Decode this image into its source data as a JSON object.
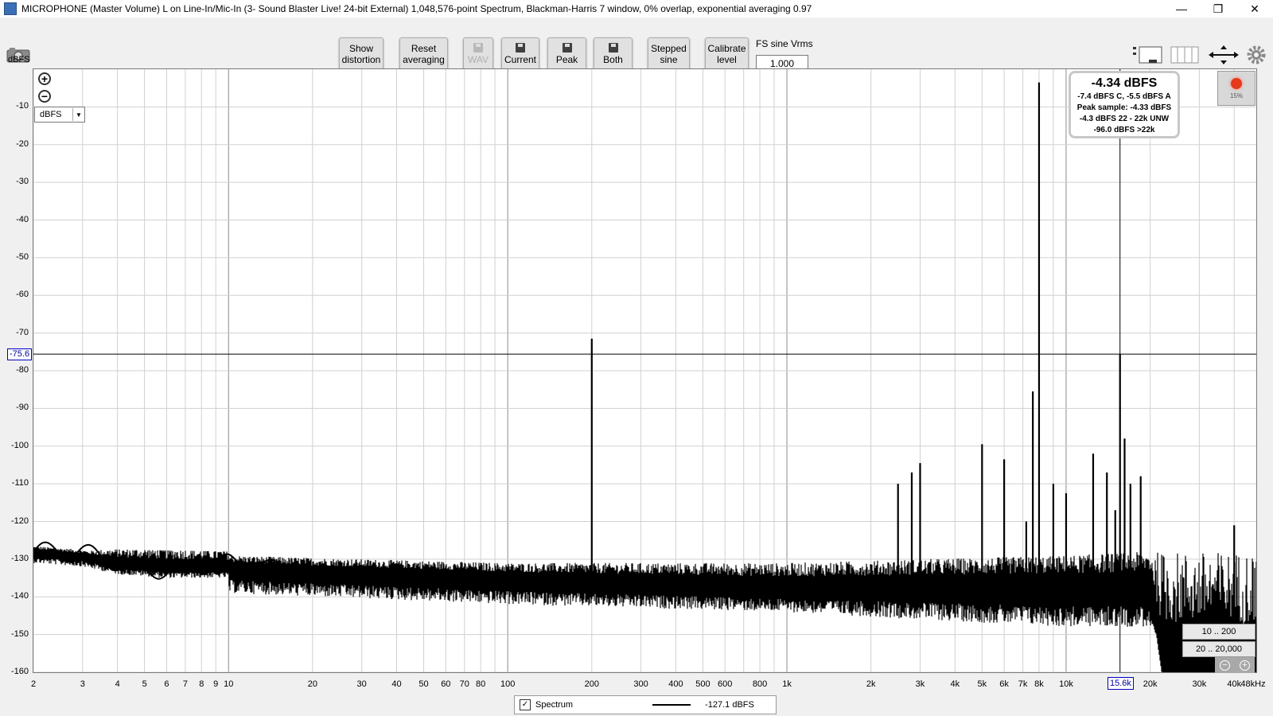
{
  "window": {
    "title": "MICROPHONE (Master Volume) L on Line-In/Mic-In (3- Sound Blaster Live! 24-bit External) 1,048,576-point Spectrum, Blackman-Harris 7 window, 0% overlap, exponential averaging 0.97",
    "minimize": "—",
    "restore": "❐",
    "close": "✕"
  },
  "toolbar": {
    "show_distortion": [
      "Show",
      "distortion"
    ],
    "reset_averaging": [
      "Reset",
      "averaging"
    ],
    "wav": "WAV",
    "current": "Current",
    "peak": "Peak",
    "both": "Both",
    "stepped_sine": [
      "Stepped",
      "sine"
    ],
    "calibrate_level": [
      "Calibrate",
      "level"
    ],
    "fs_label": "FS sine Vrms",
    "fs_value": "1.000"
  },
  "unit_select": "dBFS",
  "cursor": {
    "y_value": "-75.6",
    "x_value": "15.6k"
  },
  "readout": {
    "main": "-4.34 dBFS",
    "lines": [
      "-7.4 dBFS C, -5.5 dBFS A",
      "Peak sample: -4.33 dBFS",
      "-4.3 dBFS 22 - 22k UNW",
      "-96.0 dBFS >22k"
    ]
  },
  "record": {
    "pct": "15%"
  },
  "ranges": [
    "10 .. 200",
    "20 .. 20,000"
  ],
  "legend": {
    "name": "Spectrum",
    "value": "-127.1 dBFS"
  },
  "colors": {
    "trace": "#000000",
    "grid": "#d0d0d0",
    "grid_major": "#8a8a8a",
    "cursor": "#000000",
    "badge": "#0000c0"
  },
  "chart_data": {
    "type": "line",
    "title": "",
    "ylabel": "dBFS",
    "xlabel": "",
    "x_scale": "log",
    "xlim": [
      2,
      48000
    ],
    "ylim": [
      -160,
      0
    ],
    "grid": true,
    "yticks": [
      -10,
      -20,
      -30,
      -40,
      -50,
      -60,
      -70,
      -80,
      -90,
      -100,
      -110,
      -120,
      -130,
      -140,
      -150,
      -160
    ],
    "xticks": [
      {
        "v": 2,
        "t": "2"
      },
      {
        "v": 3,
        "t": "3"
      },
      {
        "v": 4,
        "t": "4"
      },
      {
        "v": 5,
        "t": "5"
      },
      {
        "v": 6,
        "t": "6"
      },
      {
        "v": 7,
        "t": "7"
      },
      {
        "v": 8,
        "t": "8"
      },
      {
        "v": 9,
        "t": "9"
      },
      {
        "v": 10,
        "t": "10"
      },
      {
        "v": 20,
        "t": "20"
      },
      {
        "v": 30,
        "t": "30"
      },
      {
        "v": 40,
        "t": "40"
      },
      {
        "v": 50,
        "t": "50"
      },
      {
        "v": 60,
        "t": "60"
      },
      {
        "v": 70,
        "t": "70"
      },
      {
        "v": 80,
        "t": "80"
      },
      {
        "v": 100,
        "t": "100"
      },
      {
        "v": 200,
        "t": "200"
      },
      {
        "v": 300,
        "t": "300"
      },
      {
        "v": 400,
        "t": "400"
      },
      {
        "v": 500,
        "t": "500"
      },
      {
        "v": 600,
        "t": "600"
      },
      {
        "v": 800,
        "t": "800"
      },
      {
        "v": 1000,
        "t": "1k"
      },
      {
        "v": 2000,
        "t": "2k"
      },
      {
        "v": 3000,
        "t": "3k"
      },
      {
        "v": 4000,
        "t": "4k"
      },
      {
        "v": 5000,
        "t": "5k"
      },
      {
        "v": 6000,
        "t": "6k"
      },
      {
        "v": 7000,
        "t": "7k"
      },
      {
        "v": 8000,
        "t": "8k"
      },
      {
        "v": 10000,
        "t": "10k"
      },
      {
        "v": 20000,
        "t": "20k"
      },
      {
        "v": 30000,
        "t": "30k"
      },
      {
        "v": 40000,
        "t": "40k"
      },
      {
        "v": 48000,
        "t": "48kHz"
      }
    ],
    "series": [
      {
        "name": "Spectrum",
        "noise_floor": [
          [
            2,
            -128
          ],
          [
            3,
            -129
          ],
          [
            4,
            -131
          ],
          [
            6,
            -132
          ],
          [
            10,
            -132
          ],
          [
            20,
            -133
          ],
          [
            50,
            -134
          ],
          [
            100,
            -135
          ],
          [
            300,
            -136
          ],
          [
            1000,
            -137
          ],
          [
            3000,
            -137
          ],
          [
            10000,
            -137
          ],
          [
            15600,
            -137
          ],
          [
            20000,
            -137
          ],
          [
            22000,
            -160
          ],
          [
            48000,
            -160
          ]
        ],
        "noise_top": [
          [
            2,
            -128
          ],
          [
            10,
            -129
          ],
          [
            30,
            -130
          ],
          [
            100,
            -131
          ],
          [
            1000,
            -131
          ],
          [
            3000,
            -130
          ],
          [
            10000,
            -129
          ],
          [
            20000,
            -128
          ],
          [
            48000,
            -128
          ]
        ],
        "noise_bottom": [
          [
            10,
            -139
          ],
          [
            100,
            -142
          ],
          [
            1000,
            -144
          ],
          [
            3000,
            -146
          ],
          [
            10000,
            -148
          ],
          [
            20000,
            -148
          ],
          [
            21000,
            -150
          ],
          [
            22000,
            -160
          ],
          [
            48000,
            -160
          ]
        ],
        "peaks": [
          {
            "x": 200,
            "y": -71.5
          },
          {
            "x": 8000,
            "y": -3.5
          },
          {
            "x": 15600,
            "y": -75.6
          },
          {
            "x": 7600,
            "y": -85.5
          },
          {
            "x": 5000,
            "y": -99.5
          },
          {
            "x": 10000,
            "y": -112.5
          },
          {
            "x": 3000,
            "y": -104.5
          },
          {
            "x": 2800,
            "y": -107
          },
          {
            "x": 2500,
            "y": -110
          },
          {
            "x": 6000,
            "y": -103.5
          },
          {
            "x": 12500,
            "y": -102
          },
          {
            "x": 14000,
            "y": -107
          },
          {
            "x": 16200,
            "y": -98
          },
          {
            "x": 18500,
            "y": -108
          },
          {
            "x": 40000,
            "y": -121
          },
          {
            "x": 15000,
            "y": -117
          },
          {
            "x": 9000,
            "y": -110
          },
          {
            "x": 17000,
            "y": -110
          },
          {
            "x": 7200,
            "y": -120
          }
        ]
      }
    ]
  }
}
